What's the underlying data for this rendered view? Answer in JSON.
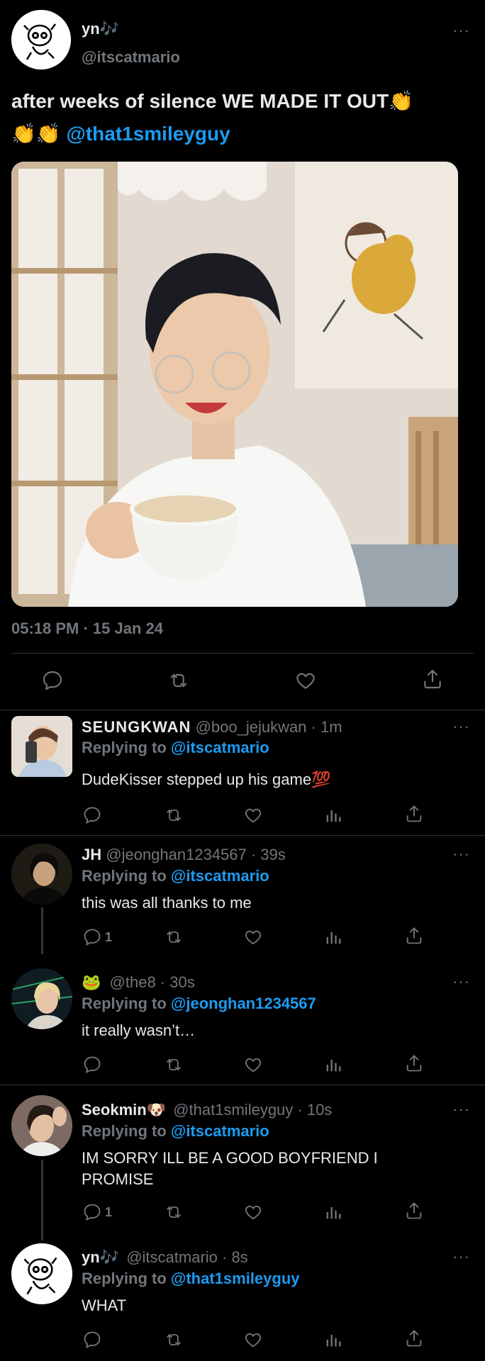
{
  "main_tweet": {
    "name": "yn🎶",
    "handle": "@itscatmario",
    "text": "after weeks of silence WE MADE IT OUT👏\n👏👏 ",
    "mention": "@that1smileyguy",
    "timestamp": "05:18 PM · 15 Jan 24"
  },
  "replies": [
    {
      "name": "SEUNGKWAN",
      "meta": "@boo_jejukwan · 1m",
      "replying_prefix": "Replying to ",
      "replying_to": "@itscatmario",
      "text": "DudeKisser stepped up his game💯",
      "reply_count": ""
    },
    {
      "name": "JH",
      "meta": "@jeonghan1234567 · 39s",
      "replying_prefix": "Replying to ",
      "replying_to": "@itscatmario",
      "text": "this was all thanks to me",
      "reply_count": "1"
    },
    {
      "name": "🐸",
      "meta": "@the8 · 30s",
      "replying_prefix": "Replying to ",
      "replying_to": "@jeonghan1234567",
      "text": "it really wasn’t…",
      "reply_count": ""
    },
    {
      "name": "Seokmin🐶",
      "meta": "@that1smileyguy · 10s",
      "replying_prefix": "Replying to ",
      "replying_to": "@itscatmario",
      "text": "IM SORRY ILL BE A GOOD BOYFRIEND I PROMISE",
      "reply_count": "1"
    },
    {
      "name": "yn🎶",
      "meta": "@itscatmario · 8s",
      "replying_prefix": "Replying to ",
      "replying_to": "@that1smileyguy",
      "text": "WHAT",
      "reply_count": ""
    }
  ],
  "colors": {
    "background": "#000000",
    "accent": "#1d9bf0",
    "muted": "#71767b",
    "divider": "#2f3336"
  },
  "icons": [
    "reply-icon",
    "retweet-icon",
    "like-icon",
    "views-icon",
    "share-icon",
    "more-icon"
  ]
}
